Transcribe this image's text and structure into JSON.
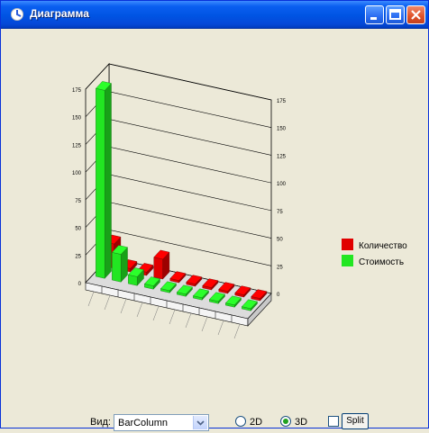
{
  "window": {
    "title": "Диаграмма",
    "icon": "app-icon"
  },
  "chart_data": {
    "type": "bar",
    "view": "3d",
    "categories": [
      "",
      "",
      "",
      "",
      "",
      "",
      "",
      "",
      "",
      ""
    ],
    "series": [
      {
        "name": "Количество",
        "color": "#e00000",
        "values": [
          22,
          3,
          3,
          18,
          2,
          2,
          2,
          2,
          2,
          2
        ]
      },
      {
        "name": "Стоимость",
        "color": "#22e622",
        "values": [
          170,
          25,
          8,
          3,
          2,
          2,
          2,
          2,
          2,
          2
        ]
      }
    ],
    "ylim": [
      0,
      175
    ],
    "left_axis_ticks": [
      "0",
      "25",
      "50",
      "75",
      "100",
      "125",
      "150",
      "175"
    ],
    "right_axis_ticks": [
      "0",
      "25",
      "50",
      "75",
      "100",
      "125",
      "150",
      "175"
    ],
    "grid": true,
    "legend_position": "right"
  },
  "controls": {
    "view_label": "Вид:",
    "view_value": "BarColumn",
    "radio_2d_label": "2D",
    "radio_3d_label": "3D",
    "split_label": "Split"
  }
}
